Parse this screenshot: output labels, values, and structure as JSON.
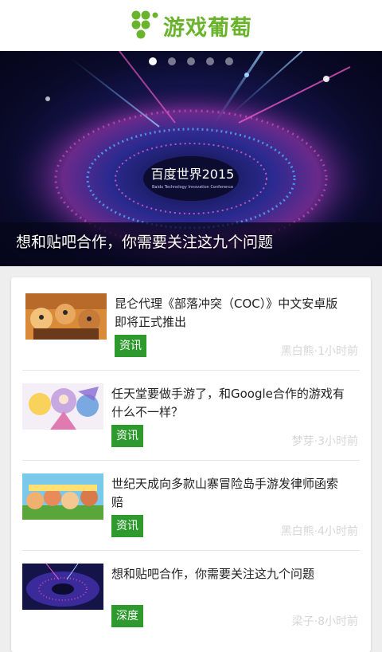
{
  "app": {
    "name": "游戏葡萄",
    "brand_color": "#6ab42d"
  },
  "banner": {
    "title": "想和贴吧合作，你需要关注这九个问题",
    "slide_count": 5,
    "active_slide": 1,
    "sign_text": "百度世界2015",
    "sign_sub": "Baidu Technology Innovation Conference"
  },
  "articles": [
    {
      "title_line1": "昆仑代理《部落冲突（COC）》中文安卓版",
      "title_line2": "即将正式推出",
      "tag": "资讯",
      "meta": "黑白熊·1小时前",
      "thumb": "clash-of-clans-art"
    },
    {
      "title_line1": "任天堂要做手游了，和Google合作的游戏有",
      "title_line2": "什么不一样？",
      "tag": "资讯",
      "meta": "梦芽·3小时前",
      "thumb": "anime-characters-art"
    },
    {
      "title_line1": "世纪天成向多款山寨冒险岛手游发律师函索",
      "title_line2": "赔",
      "tag": "资讯",
      "meta": "黑白熊·4小时前",
      "thumb": "maplestory-characters-art"
    },
    {
      "title_line1": "想和贴吧合作，你需要关注这九个问题",
      "title_line2": "",
      "tag": "深度",
      "meta": "梁子·8小时前",
      "thumb": "baidu-conference-stage"
    }
  ],
  "colors": {
    "tag_bg": "#2e9a2e",
    "meta_text": "#d6d6d6"
  }
}
